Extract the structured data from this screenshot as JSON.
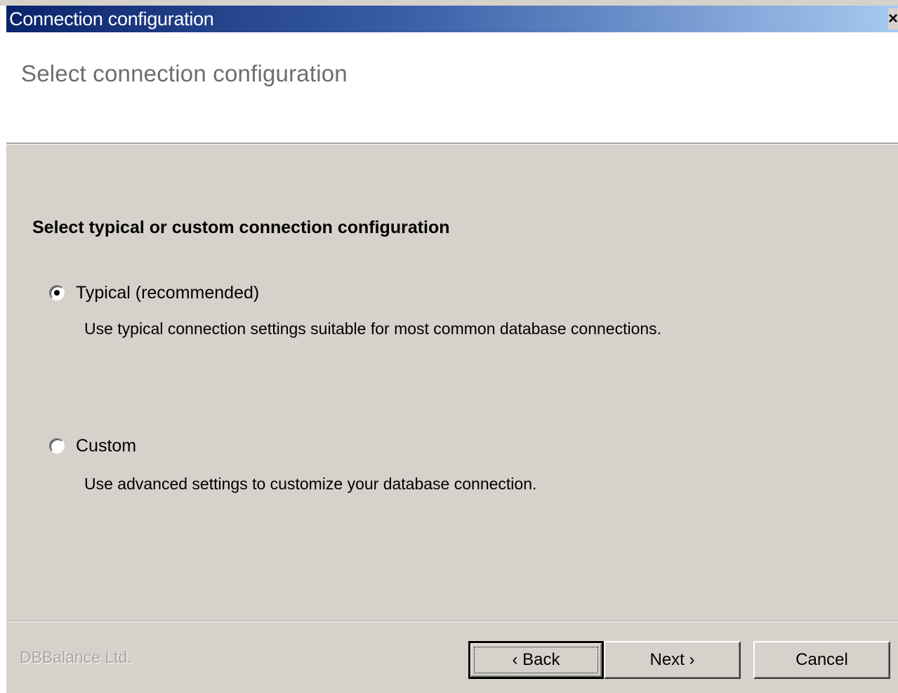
{
  "window": {
    "title": "Connection configuration",
    "close_glyph": "×"
  },
  "header": {
    "title": "Select connection configuration"
  },
  "main": {
    "heading": "Select typical or custom connection configuration",
    "options": [
      {
        "label": "Typical (recommended)",
        "description": "Use typical connection settings suitable for most common database connections.",
        "selected": true
      },
      {
        "label": "Custom",
        "description": "Use advanced settings to customize your database connection.",
        "selected": false
      }
    ]
  },
  "footer": {
    "company": "DBBalance Ltd.",
    "back_label": "‹ Back",
    "next_label": "Next ›",
    "cancel_label": "Cancel"
  },
  "colors": {
    "titlebar_start": "#0a246a",
    "titlebar_end": "#a6caf0",
    "dialog_face": "#d6d2cb"
  }
}
